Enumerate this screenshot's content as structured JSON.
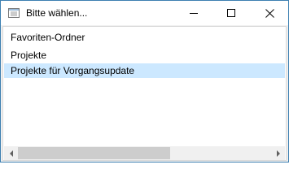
{
  "window": {
    "title": "Bitte wählen...",
    "controls": [
      "minimize-icon",
      "maximize-icon",
      "close-icon"
    ],
    "accent_color": "#3c7fb1"
  },
  "list": {
    "items": [
      {
        "label": "Favoriten-Ordner",
        "selected": false
      },
      {
        "label": "Projekte",
        "selected": false
      },
      {
        "label": "Projekte für Vorgangsupdate",
        "selected": true
      }
    ],
    "selection_color": "#cce8ff"
  },
  "scrollbar": {
    "orientation": "horizontal",
    "thumb_fraction": 0.6,
    "position": 0
  }
}
